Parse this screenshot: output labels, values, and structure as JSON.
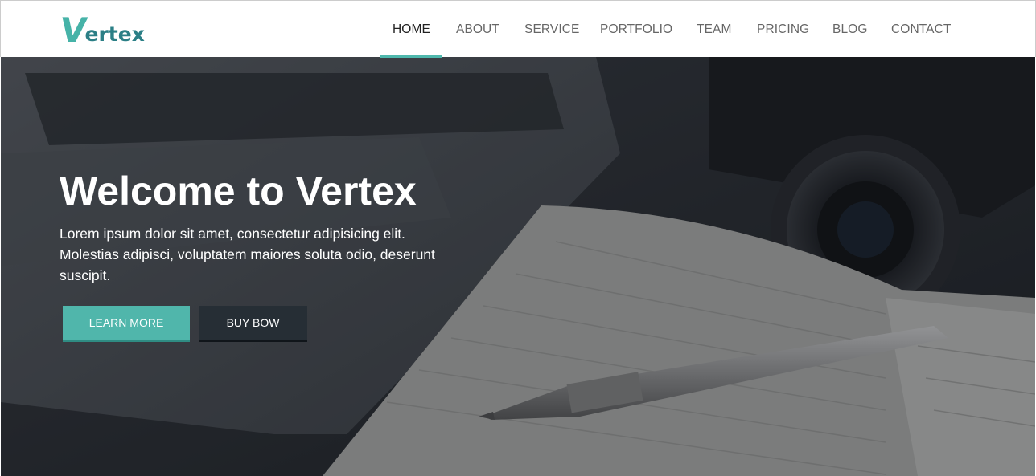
{
  "brand": {
    "logo_initial": "V",
    "logo_rest": "ertex",
    "accent": "#4fb8ad",
    "logo_color": "#2b7f86"
  },
  "nav": {
    "items": [
      {
        "label": "HOME",
        "active": true
      },
      {
        "label": "ABOUT"
      },
      {
        "label": "SERVICE"
      },
      {
        "label": "PORTFOLIO"
      },
      {
        "label": "TEAM"
      },
      {
        "label": "PRICING"
      },
      {
        "label": "BLOG"
      },
      {
        "label": "CONTACT"
      }
    ]
  },
  "hero": {
    "title": "Welcome to Vertex",
    "text": "Lorem ipsum dolor sit amet, consectetur adipisicing elit. Molestias adipisci, voluptatem maiores soluta odio, deserunt suscipit.",
    "primary_button": "LEARN MORE",
    "secondary_button": "BUY BOW"
  }
}
